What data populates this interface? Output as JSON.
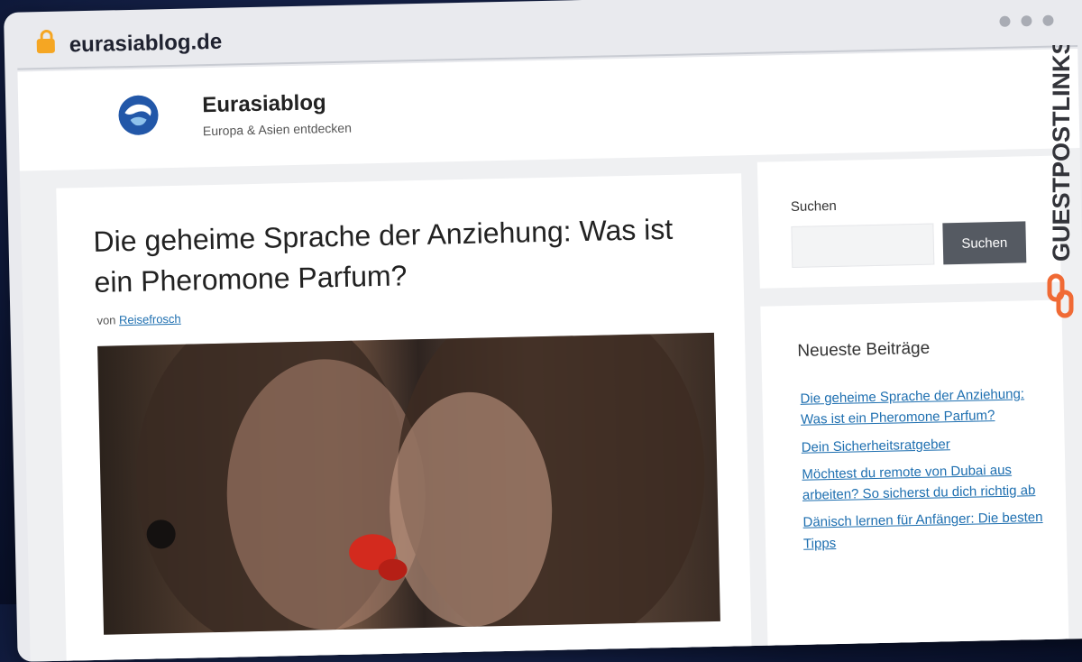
{
  "browser": {
    "url": "eurasiablog.de"
  },
  "site": {
    "title": "Eurasiablog",
    "tagline": "Europa & Asien entdecken"
  },
  "article": {
    "title": "Die geheime Sprache der Anziehung: Was ist ein Pheromone Parfum?",
    "byline_prefix": "von",
    "author": "Reisefrosch"
  },
  "sidebar": {
    "search": {
      "label": "Suchen",
      "button": "Suchen"
    },
    "recent": {
      "title": "Neueste Beiträge",
      "posts": [
        "Die geheime Sprache der Anziehung: Was ist ein Pheromone Parfum?",
        "Dein Sicherheitsratgeber",
        "Möchtest du remote von Dubai aus arbeiten? So sicherst du dich richtig ab",
        "Dänisch lernen für Anfänger: Die besten Tipps"
      ]
    }
  },
  "watermark": {
    "text": "GUESTPOSTLINKS"
  },
  "colors": {
    "link": "#1e6fb0",
    "button": "#555a62",
    "brand": "#f06a35",
    "lock": "#f5a623"
  }
}
